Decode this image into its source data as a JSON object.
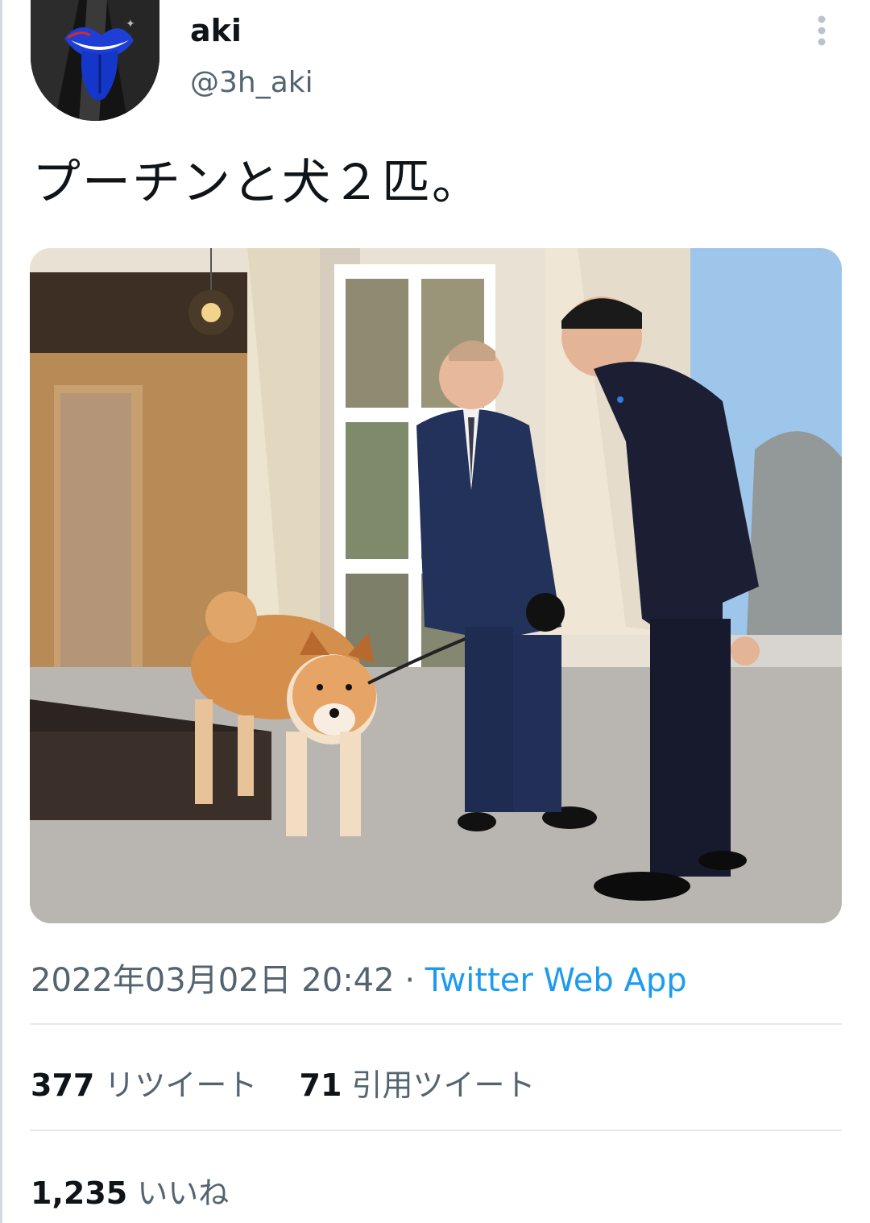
{
  "author": {
    "display_name": "aki",
    "handle": "@3h_aki"
  },
  "tweet": {
    "text": "プーチンと犬２匹。"
  },
  "meta": {
    "timestamp": "2022年03月02日 20:42",
    "separator": "·",
    "source": "Twitter Web App"
  },
  "stats": {
    "retweets_count": "377",
    "retweets_label": "リツイート",
    "quotes_count": "71",
    "quotes_label": "引用ツイート",
    "likes_count": "1,235",
    "likes_label": "いいね"
  },
  "icons": {
    "more": "more-vertical-icon",
    "avatar_logo": "lips-tongue-logo"
  },
  "colors": {
    "link": "#1d9bf0",
    "secondary_text": "#536471",
    "primary_text": "#0f1419",
    "divider": "#e4e9ec"
  }
}
